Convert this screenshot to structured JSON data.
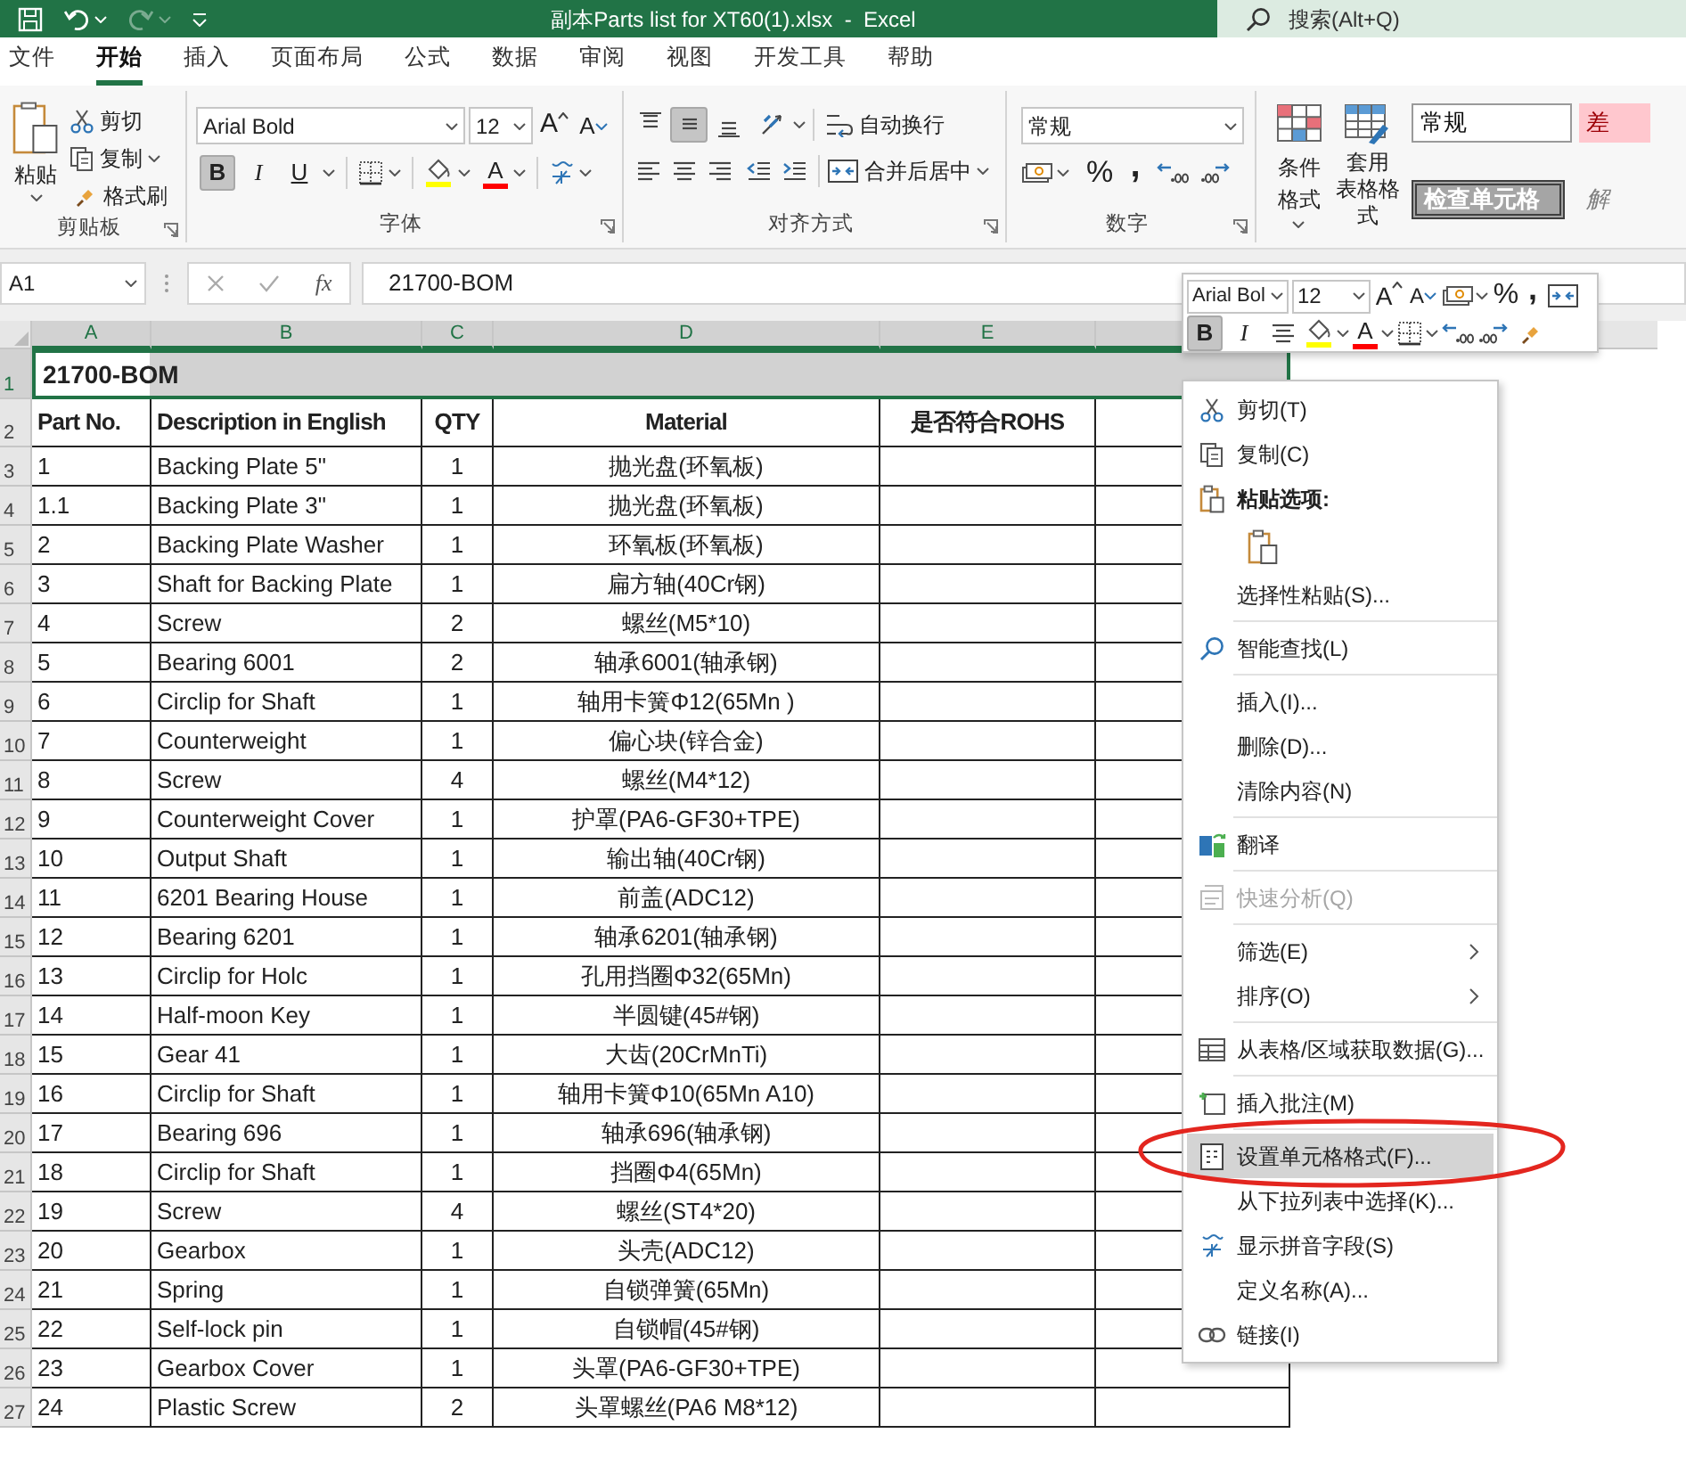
{
  "title_bar": {
    "title": "副本Parts list for XT60(1).xlsx  -  Excel",
    "redo_disabled": true,
    "search": {
      "placeholder": "搜索(Alt+Q)"
    }
  },
  "tabs": [
    {
      "label": "文件",
      "selected": false
    },
    {
      "label": "开始",
      "selected": true
    },
    {
      "label": "插入",
      "selected": false
    },
    {
      "label": "页面布局",
      "selected": false
    },
    {
      "label": "公式",
      "selected": false
    },
    {
      "label": "数据",
      "selected": false
    },
    {
      "label": "审阅",
      "selected": false
    },
    {
      "label": "视图",
      "selected": false
    },
    {
      "label": "开发工具",
      "selected": false
    },
    {
      "label": "帮助",
      "selected": false
    }
  ],
  "ribbon": {
    "clipboard": {
      "label": "剪贴板",
      "paste": "粘贴",
      "cut": "剪切",
      "copy": "复制",
      "format_painter": "格式刷"
    },
    "font": {
      "label": "字体",
      "font_name": "Arial Bold",
      "font_size": "12",
      "grow": "A",
      "shrink": "A",
      "font_color": "A",
      "styles": [
        {
          "kind": "bold",
          "glyph": "B",
          "selected": true
        },
        {
          "kind": "italic",
          "glyph": "I",
          "selected": false
        },
        {
          "kind": "underline",
          "glyph": "U",
          "selected": false
        }
      ]
    },
    "alignment": {
      "label": "对齐方式",
      "vertical": [
        {
          "selected": false
        },
        {
          "selected": true
        },
        {
          "selected": false
        }
      ],
      "horizontal": [
        {
          "selected": false
        },
        {
          "selected": false
        },
        {
          "selected": false
        }
      ],
      "wrap_text": "自动换行",
      "merge_center": "合并后居中"
    },
    "number": {
      "label": "数字",
      "format": "常规",
      "percent": "%",
      "comma": ","
    },
    "styles": {
      "conditional_formatting": "条件格式",
      "format_as_table": [
        "套用",
        "表格格式"
      ],
      "cell_styles": [
        {
          "kind": "normal",
          "label": "常规"
        },
        {
          "kind": "bad",
          "label": "差"
        },
        {
          "kind": "check",
          "label": "检查单元格"
        },
        {
          "kind": "explanatory",
          "label": "解"
        }
      ]
    }
  },
  "formula_bar": {
    "name_box": "A1",
    "function_label": "fx",
    "value": "21700-BOM"
  },
  "sheet": {
    "columns": [
      {
        "label": "A",
        "selected": true
      },
      {
        "label": "B",
        "selected": true
      },
      {
        "label": "C",
        "selected": true
      },
      {
        "label": "D",
        "selected": true
      },
      {
        "label": "E",
        "selected": true
      }
    ],
    "title_row": {
      "row_number": "1",
      "value": "21700-BOM",
      "selected": true
    },
    "header_row": {
      "row_number": "2",
      "cells": [
        "Part No.",
        "Description in English",
        "QTY",
        "Material",
        "是否符合ROHS"
      ]
    },
    "rows": [
      {
        "row_number": "3",
        "cells": [
          "1",
          "Backing Plate 5\"",
          "1",
          "抛光盘(环氧板)"
        ]
      },
      {
        "row_number": "4",
        "cells": [
          "1.1",
          "Backing Plate 3\"",
          "1",
          "抛光盘(环氧板)"
        ]
      },
      {
        "row_number": "5",
        "cells": [
          "2",
          "Backing Plate Washer",
          "1",
          "环氧板(环氧板)"
        ]
      },
      {
        "row_number": "6",
        "cells": [
          "3",
          "Shaft for Backing Plate",
          "1",
          "扁方轴(40Cr钢)"
        ]
      },
      {
        "row_number": "7",
        "cells": [
          "4",
          "Screw",
          "2",
          "螺丝(M5*10)"
        ]
      },
      {
        "row_number": "8",
        "cells": [
          "5",
          "Bearing 6001",
          "2",
          "轴承6001(轴承钢)"
        ]
      },
      {
        "row_number": "9",
        "cells": [
          "6",
          "Circlip for Shaft",
          "1",
          "轴用卡簧Φ12(65Mn )"
        ]
      },
      {
        "row_number": "10",
        "cells": [
          "7",
          "Counterweight",
          "1",
          "偏心块(锌合金)"
        ]
      },
      {
        "row_number": "11",
        "cells": [
          "8",
          "Screw",
          "4",
          "螺丝(M4*12)"
        ]
      },
      {
        "row_number": "12",
        "cells": [
          "9",
          "Counterweight Cover",
          "1",
          "护罩(PA6-GF30+TPE)"
        ]
      },
      {
        "row_number": "13",
        "cells": [
          "10",
          "Output Shaft",
          "1",
          "输出轴(40Cr钢)"
        ]
      },
      {
        "row_number": "14",
        "cells": [
          "11",
          "6201 Bearing House",
          "1",
          "前盖(ADC12)"
        ]
      },
      {
        "row_number": "15",
        "cells": [
          "12",
          "Bearing 6201",
          "1",
          "轴承6201(轴承钢)"
        ]
      },
      {
        "row_number": "16",
        "cells": [
          "13",
          "Circlip for Holc",
          "1",
          "孔用挡圈Φ32(65Mn)"
        ]
      },
      {
        "row_number": "17",
        "cells": [
          "14",
          "Half-moon Key",
          "1",
          "半圆键(45#钢)"
        ]
      },
      {
        "row_number": "18",
        "cells": [
          "15",
          "Gear 41",
          "1",
          "大齿(20CrMnTi)"
        ]
      },
      {
        "row_number": "19",
        "cells": [
          "16",
          "Circlip for Shaft",
          "1",
          "轴用卡簧Φ10(65Mn  A10)"
        ]
      },
      {
        "row_number": "20",
        "cells": [
          "17",
          "Bearing 696",
          "1",
          "轴承696(轴承钢)"
        ]
      },
      {
        "row_number": "21",
        "cells": [
          "18",
          "Circlip for Shaft",
          "1",
          "挡圈Φ4(65Mn)"
        ]
      },
      {
        "row_number": "22",
        "cells": [
          "19",
          "Screw",
          "4",
          "螺丝(ST4*20)"
        ]
      },
      {
        "row_number": "23",
        "cells": [
          "20",
          "Gearbox",
          "1",
          "头壳(ADC12)"
        ]
      },
      {
        "row_number": "24",
        "cells": [
          "21",
          "Spring",
          "1",
          "自锁弹簧(65Mn)"
        ]
      },
      {
        "row_number": "25",
        "cells": [
          "22",
          "Self-lock pin",
          "1",
          "自锁帽(45#钢)"
        ]
      },
      {
        "row_number": "26",
        "cells": [
          "23",
          "Gearbox Cover",
          "1",
          "头罩(PA6-GF30+TPE)"
        ]
      },
      {
        "row_number": "27",
        "cells": [
          "24",
          "Plastic Screw",
          "2",
          "头罩螺丝(PA6 M8*12)"
        ]
      }
    ]
  },
  "mini_toolbar": {
    "font_name": "Arial Bol",
    "font_size": "12",
    "grow": "A",
    "shrink": "A",
    "percent": "%",
    "comma": ",",
    "font_color": "A",
    "styles": [
      {
        "kind": "bold",
        "glyph": "B",
        "selected": true
      },
      {
        "kind": "italic",
        "glyph": "I",
        "selected": false
      }
    ]
  },
  "context_menu": {
    "sections": [
      [
        {
          "kind": "item",
          "label": "剪切(T)",
          "selected": false,
          "disabled": false,
          "submenu": false
        },
        {
          "kind": "item",
          "label": "复制(C)",
          "selected": false,
          "disabled": false,
          "submenu": false
        },
        {
          "kind": "header",
          "label": "粘贴选项:"
        },
        {
          "kind": "paste",
          "selected": false
        },
        {
          "kind": "item",
          "label": "选择性粘贴(S)...",
          "selected": false,
          "disabled": false,
          "submenu": false
        }
      ],
      [
        {
          "kind": "item",
          "label": "智能查找(L)",
          "selected": false,
          "disabled": false,
          "submenu": false
        }
      ],
      [
        {
          "kind": "item",
          "label": "插入(I)...",
          "selected": false,
          "disabled": false,
          "submenu": false
        },
        {
          "kind": "item",
          "label": "删除(D)...",
          "selected": false,
          "disabled": false,
          "submenu": false
        },
        {
          "kind": "item",
          "label": "清除内容(N)",
          "selected": false,
          "disabled": false,
          "submenu": false
        }
      ],
      [
        {
          "kind": "item",
          "label": "翻译",
          "selected": false,
          "disabled": false,
          "submenu": false
        }
      ],
      [
        {
          "kind": "item",
          "label": "快速分析(Q)",
          "selected": false,
          "disabled": true,
          "submenu": false
        }
      ],
      [
        {
          "kind": "item",
          "label": "筛选(E)",
          "selected": false,
          "disabled": false,
          "submenu": true
        },
        {
          "kind": "item",
          "label": "排序(O)",
          "selected": false,
          "disabled": false,
          "submenu": true
        }
      ],
      [
        {
          "kind": "item",
          "label": "从表格/区域获取数据(G)...",
          "selected": false,
          "disabled": false,
          "submenu": false
        }
      ],
      [
        {
          "kind": "item",
          "label": "插入批注(M)",
          "selected": false,
          "disabled": false,
          "submenu": false
        }
      ],
      [
        {
          "kind": "item",
          "label": "设置单元格格式(F)...",
          "selected": true,
          "disabled": false,
          "submenu": false
        },
        {
          "kind": "item",
          "label": "从下拉列表中选择(K)...",
          "selected": false,
          "disabled": false,
          "submenu": false
        },
        {
          "kind": "item",
          "label": "显示拼音字段(S)",
          "selected": false,
          "disabled": false,
          "submenu": false
        },
        {
          "kind": "item",
          "label": "定义名称(A)...",
          "selected": false,
          "disabled": false,
          "submenu": false
        },
        {
          "kind": "item",
          "label": "链接(I)",
          "selected": false,
          "disabled": false,
          "submenu": false
        }
      ]
    ]
  },
  "annotation": {
    "kind": "ellipse"
  }
}
